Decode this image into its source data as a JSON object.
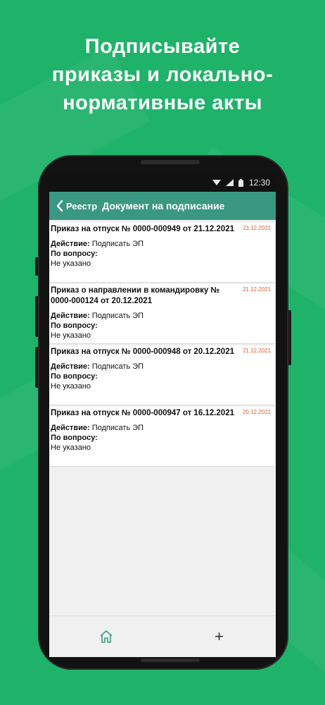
{
  "promo": {
    "headline_lines": [
      "Подписывайте",
      "приказы и локально-",
      "нормативные акты"
    ]
  },
  "statusbar": {
    "time": "12:30",
    "icons": [
      "wifi-icon",
      "signal-icon",
      "battery-icon"
    ]
  },
  "appbar": {
    "back_label": "Реестр",
    "title": "Документ на подписание"
  },
  "documents": [
    {
      "title": "Приказ на отпуск № 0000-000949 от 21.12.2021",
      "date": "23.12.2021",
      "action_label": "Действие:",
      "action_value": "Подписать ЭП",
      "question_label": "По вопросу:",
      "question_value": "Не указано"
    },
    {
      "title": "Приказ о направлении в командировку № 0000-000124 от 20.12.2021",
      "date": "21.12.2021",
      "action_label": "Действие:",
      "action_value": "Подписать ЭП",
      "question_label": "По вопросу:",
      "question_value": "Не указано"
    },
    {
      "title": "Приказ на отпуск № 0000-000948 от 20.12.2021",
      "date": "21.12.2021",
      "action_label": "Действие:",
      "action_value": "Подписать ЭП",
      "question_label": "По вопросу:",
      "question_value": "Не указано"
    },
    {
      "title": "Приказ на отпуск № 0000-000947 от 16.12.2021",
      "date": "20.12.2021",
      "action_label": "Действие:",
      "action_value": "Подписать ЭП",
      "question_label": "По вопросу:",
      "question_value": "Не указано"
    }
  ],
  "navbar": {
    "home_icon": "home-icon",
    "add_symbol": "+"
  },
  "colors": {
    "background": "#1fb36a",
    "appbar": "#3a9882",
    "date": "#d9612f"
  }
}
